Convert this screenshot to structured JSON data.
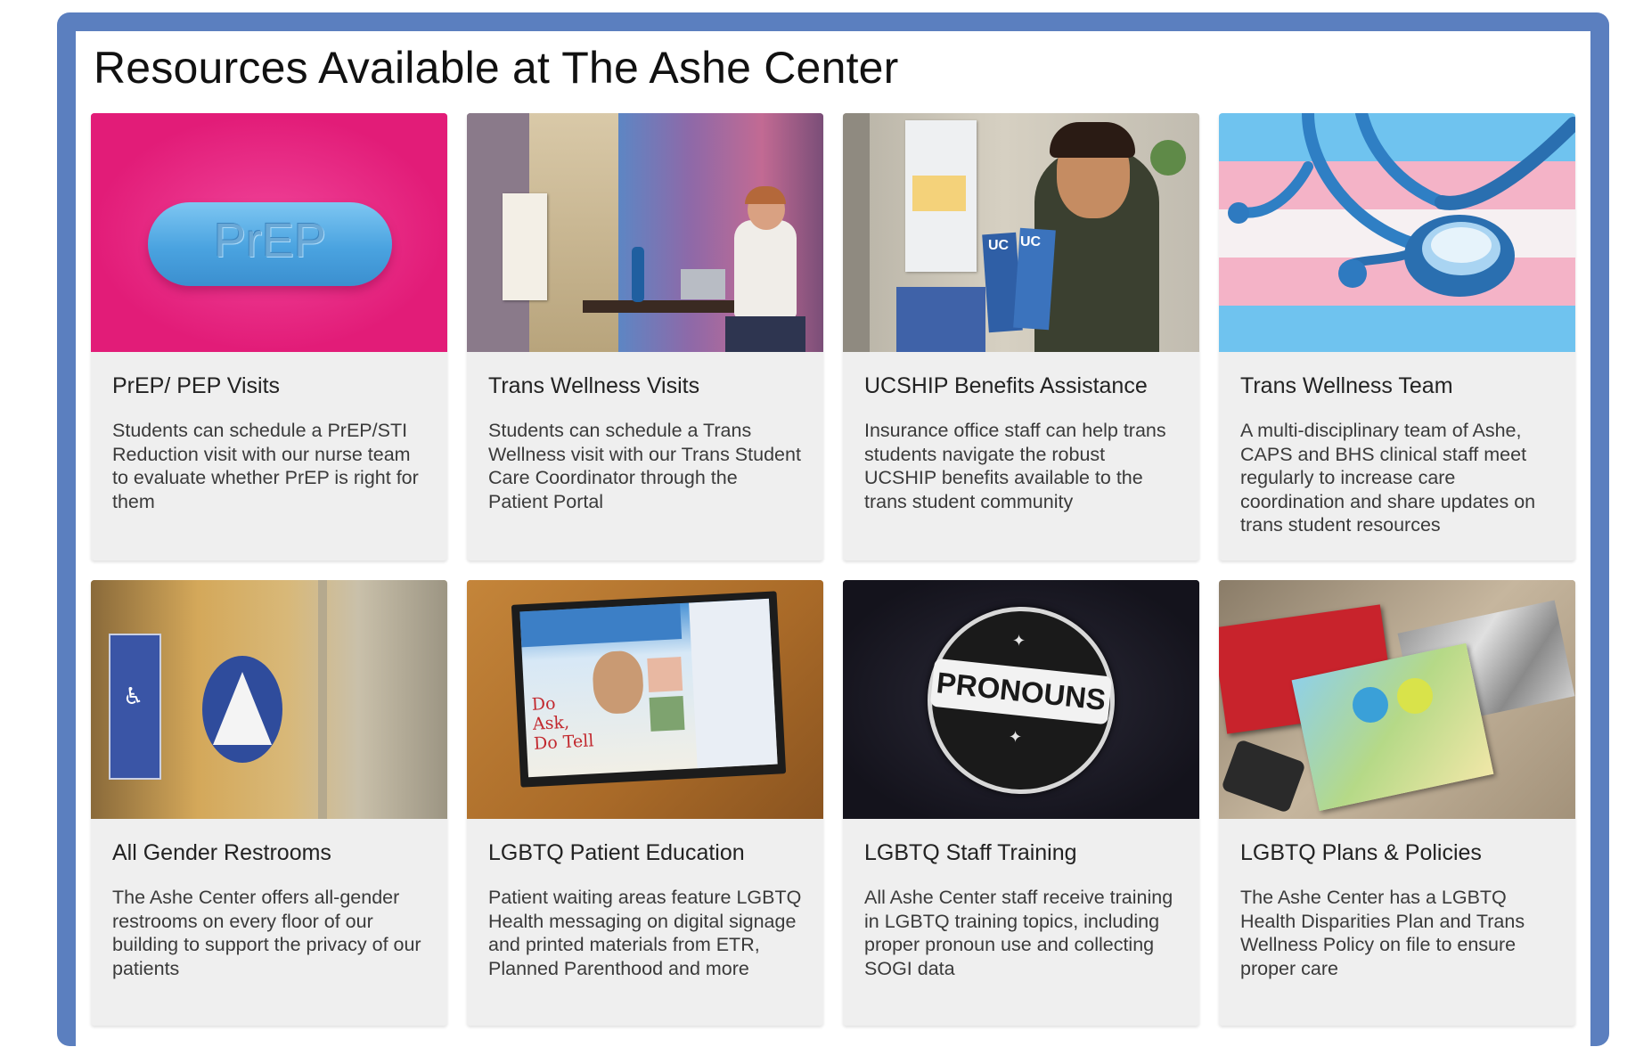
{
  "page": {
    "heading": "Resources Available at The Ashe Center"
  },
  "colors": {
    "frame": "#5b7fbf",
    "card_bg": "#efefef"
  },
  "cards": [
    {
      "title": "PrEP/ PEP Visits",
      "text": "Students can schedule a PrEP/STI Reduction visit with our nurse team to evaluate whether PrEP is right for them",
      "image": "prep-pill-image",
      "image_text": "PrEP"
    },
    {
      "title": "Trans Wellness Visits",
      "text": "Students can schedule a Trans Wellness visit with our Trans Student Care Coordinator through the Patient Portal",
      "image": "person-at-desk-photo"
    },
    {
      "title": "UCSHIP Benefits Assistance",
      "text": "Insurance office staff can help trans students navigate the robust UCSHIP benefits available to the trans student community",
      "image": "staff-with-brochures-photo"
    },
    {
      "title": "Trans Wellness Team",
      "text": "A multi-disciplinary team of Ashe, CAPS and BHS clinical staff meet regularly to increase care coordination and share updates on trans student resources",
      "image": "stethoscope-trans-flag-image"
    },
    {
      "title": "All Gender Restrooms",
      "text": "The Ashe Center offers all-gender restrooms on every floor of our building to support the privacy of our patients",
      "image": "restroom-sign-photo"
    },
    {
      "title": "LGBTQ Patient Education",
      "text": "Patient waiting areas feature LGBTQ Health messaging on digital signage and printed materials from ETR, Planned Parenthood and more",
      "image": "digital-signage-photo",
      "image_text": "Do Ask, Do Tell"
    },
    {
      "title": "LGBTQ Staff Training",
      "text": "All Ashe Center staff receive training in LGBTQ training topics, including proper pronoun use and collecting SOGI data",
      "image": "pronouns-pin-photo",
      "image_text": "PRONOUNS"
    },
    {
      "title": "LGBTQ Plans & Policies",
      "text": "The Ashe Center has a LGBTQ Health Disparities Plan and Trans Wellness Policy on file to ensure proper care",
      "image": "brochures-and-condoms-photo"
    }
  ]
}
